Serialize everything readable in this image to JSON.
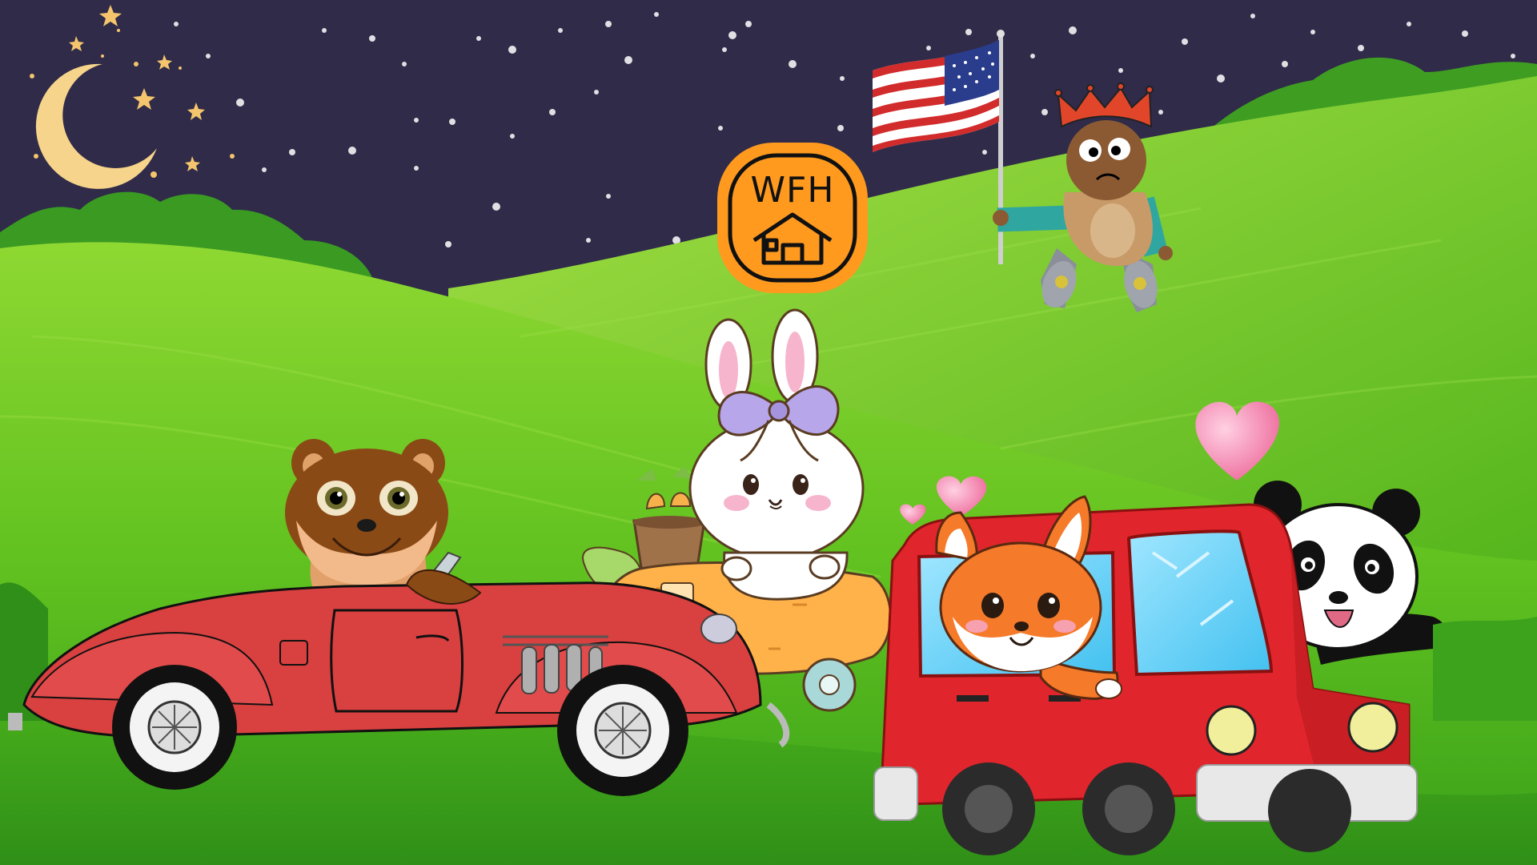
{
  "scene": {
    "wfh_badge": {
      "label": "WFH",
      "icon": "house-icon"
    },
    "colors": {
      "night_sky": "#2f2b49",
      "hill_green": "#5cc21f",
      "bush_green": "#3a9a22",
      "moon": "#f7d48b",
      "red_car": "#d94040",
      "red_van": "#e0262c",
      "badge_orange": "#ff9a1f",
      "heart_pink": "#f07aa6",
      "carrot_orange": "#ffb24a"
    },
    "characters": [
      {
        "name": "raccoon-driver",
        "icon": "raccoon-icon"
      },
      {
        "name": "bunny-in-carrot-car",
        "icon": "bunny-icon"
      },
      {
        "name": "fox-in-van",
        "icon": "fox-icon"
      },
      {
        "name": "panda-waving",
        "icon": "panda-icon"
      },
      {
        "name": "crowned-kid-with-flag",
        "icon": "flag-icon"
      }
    ]
  }
}
